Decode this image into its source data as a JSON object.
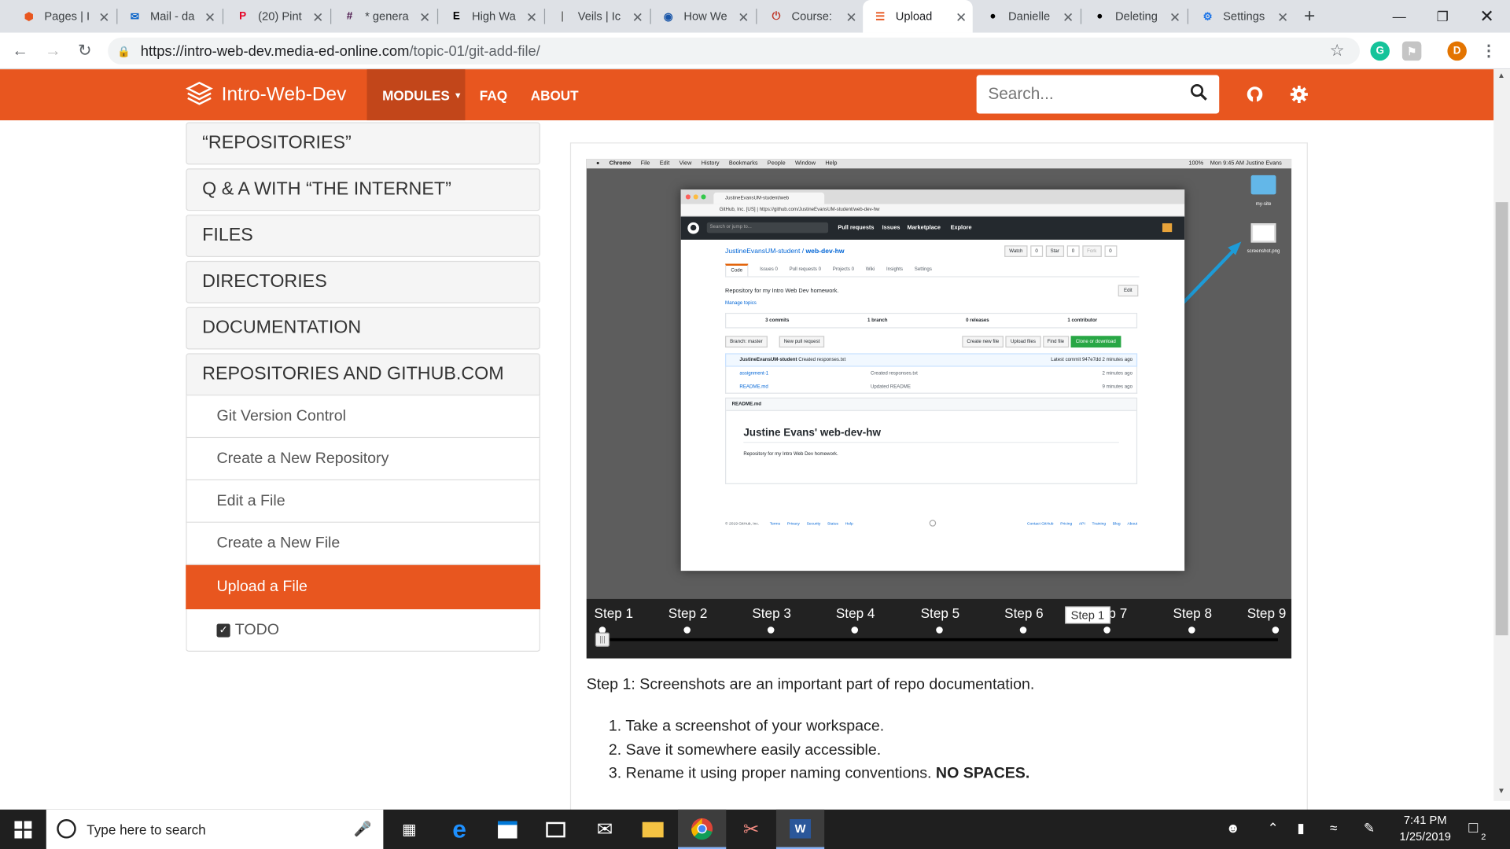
{
  "browser": {
    "tabs": [
      {
        "title": "Pages | I",
        "icon": "codepen-icon",
        "color": "#e8561f"
      },
      {
        "title": "Mail - da",
        "icon": "outlook-icon",
        "color": "#0a64c9"
      },
      {
        "title": "(20) Pint",
        "icon": "pinterest-icon",
        "color": "#e60023"
      },
      {
        "title": "* genera",
        "icon": "slack-icon",
        "color": "#4a154b"
      },
      {
        "title": "High Wa",
        "icon": "exp-icon",
        "color": "#000000"
      },
      {
        "title": "Veils | Ic",
        "icon": "blank-icon",
        "color": "#777777"
      },
      {
        "title": "How We",
        "icon": "lens-icon",
        "color": "#1a56a8"
      },
      {
        "title": "Course:",
        "icon": "power-icon",
        "color": "#c0392b"
      },
      {
        "title": "Upload",
        "icon": "site-icon",
        "color": "#e8561f",
        "active": true
      },
      {
        "title": "Danielle",
        "icon": "github-icon",
        "color": "#000000"
      },
      {
        "title": "Deleting",
        "icon": "github-icon",
        "color": "#000000"
      },
      {
        "title": "Settings",
        "icon": "gear-icon",
        "color": "#1a73e8"
      }
    ],
    "url_host": "https://intro-web-dev.media-ed-online.com",
    "url_path": "/topic-01/git-add-file/",
    "new_tab": "+",
    "profile_letter": "D",
    "ext_letter": "G"
  },
  "site": {
    "brand": "Intro-Web-Dev",
    "nav": {
      "modules": "MODULES",
      "faq": "FAQ",
      "about": "ABOUT"
    },
    "search_placeholder": "Search..."
  },
  "sidebar": {
    "sections": [
      "“REPOSITORIES”",
      "Q & A WITH “THE INTERNET”",
      "FILES",
      "DIRECTORIES",
      "DOCUMENTATION",
      "REPOSITORIES AND GITHUB.COM"
    ],
    "items": [
      {
        "label": "Git Version Control"
      },
      {
        "label": "Create a New Repository"
      },
      {
        "label": "Edit a File"
      },
      {
        "label": "Create a New File"
      },
      {
        "label": "Upload a File",
        "active": true
      },
      {
        "label": "TODO",
        "checked": true
      }
    ]
  },
  "screenshot": {
    "mac_menu": [
      "Chrome",
      "File",
      "Edit",
      "View",
      "History",
      "Bookmarks",
      "People",
      "Window",
      "Help"
    ],
    "mac_status": "Mon 9:45 AM   Justine Evans",
    "mac_battery": "100%",
    "desktop_items": [
      "my-site",
      "screenshot.png"
    ],
    "tab_title": "JustineEvansUM-student/web",
    "address": "GitHub, Inc. [US]  |  https://github.com/JustineEvansUM-student/web-dev-hw",
    "gh_search": "Search or jump to...",
    "gh_nav": [
      "Pull requests",
      "Issues",
      "Marketplace",
      "Explore"
    ],
    "repo_owner": "JustineEvansUM-student",
    "repo_name": "web-dev-hw",
    "repo_buttons": [
      "Watch",
      "0",
      "Star",
      "0",
      "Fork",
      "0"
    ],
    "repo_tabs": [
      "Code",
      "Issues 0",
      "Pull requests 0",
      "Projects 0",
      "Wiki",
      "Insights",
      "Settings"
    ],
    "description": "Repository for my Intro Web Dev homework.",
    "manage_topics": "Manage topics",
    "edit": "Edit",
    "stats": [
      "3 commits",
      "1 branch",
      "0 releases",
      "1 contributor"
    ],
    "branch": "Branch: master",
    "new_pr": "New pull request",
    "file_actions": [
      "Create new file",
      "Upload files",
      "Find file",
      "Clone or download"
    ],
    "last_commit_user": "JustineEvansUM-student",
    "last_commit_msg": "Created responses.txt",
    "latest_commit": "Latest commit 947e7dd 2 minutes ago",
    "files": [
      {
        "name": "assignment-1",
        "msg": "Created responses.txt",
        "age": "2 minutes ago"
      },
      {
        "name": "README.md",
        "msg": "Updated README",
        "age": "9 minutes ago"
      }
    ],
    "readme_label": "README.md",
    "readme_title": "Justine Evans' web-dev-hw",
    "readme_text": "Repository for my Intro Web Dev homework.",
    "footer_left": "© 2019 GitHub, Inc.",
    "footer_links_left": [
      "Terms",
      "Privacy",
      "Security",
      "Status",
      "Help"
    ],
    "footer_links_right": [
      "Contact GitHub",
      "Pricing",
      "API",
      "Training",
      "Blog",
      "About"
    ]
  },
  "slider": {
    "steps": [
      "Step 1",
      "Step 2",
      "Step 3",
      "Step 4",
      "Step 5",
      "Step 6",
      "Step 7",
      "Step 8",
      "Step 9"
    ],
    "tooltip": "Step 1",
    "current": 1
  },
  "content": {
    "caption": "Step 1: Screenshots are an important part of repo documentation.",
    "list": [
      "Take a screenshot of your workspace.",
      "Save it somewhere easily accessible.",
      "Rename it using proper naming conventions."
    ],
    "emphasis": "NO SPACES."
  },
  "taskbar": {
    "search_placeholder": "Type here to search",
    "time": "7:41 PM",
    "date": "1/25/2019",
    "notifications": "2"
  }
}
